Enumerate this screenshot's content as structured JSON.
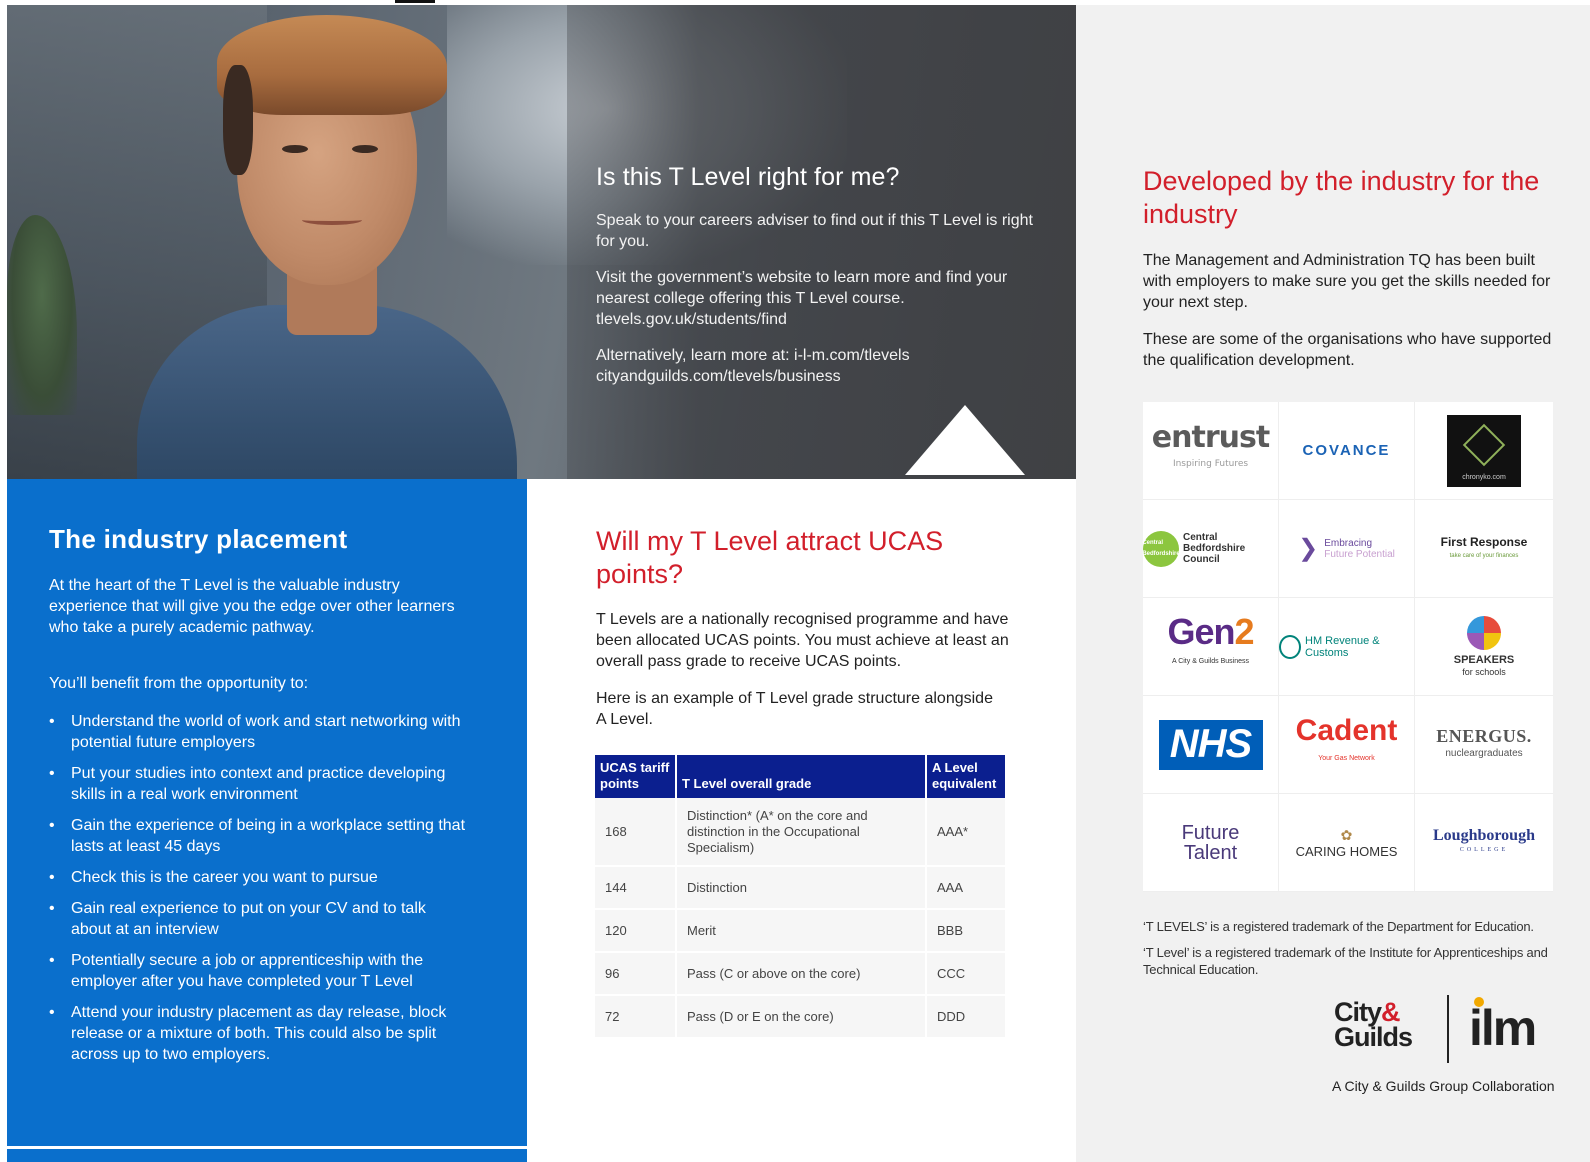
{
  "photo_section": {
    "title": "Is this T Level right for me?",
    "paragraphs": [
      "Speak to your careers adviser to find out if this T Level is right for you.",
      "Visit the government’s website to learn more and find your nearest college offering this T Level course. tlevels.gov.uk/students/find",
      "Alternatively, learn more at: i-l-m.com/tlevels cityandguilds.com/tlevels/business"
    ]
  },
  "industry": {
    "title": "Developed by the industry for the industry",
    "paragraphs": [
      "The Management and Administration TQ has been built with employers to make sure you get the skills needed for your next step.",
      "These are some of the organisations who have supported the qualification development."
    ],
    "logos": {
      "entrust": {
        "name": "entrust",
        "tagline": "Inspiring Futures"
      },
      "covance": {
        "name": "COVANCE"
      },
      "chronyko": {
        "name": "chronyko.com"
      },
      "cbc": {
        "badge": "Central Bedfordshire",
        "name": "Central Bedfordshire Council"
      },
      "embracing": {
        "line1": "Embracing",
        "line2": "Future Potential"
      },
      "first_response": {
        "name": "First Response",
        "tagline": "take care of your finances"
      },
      "gen2": {
        "name_a": "Gen",
        "name_b": "2",
        "tagline": "A City & Guilds Business"
      },
      "hmrc": {
        "name": "HM Revenue & Customs"
      },
      "speakers": {
        "name": "SPEAKERS",
        "tagline": "for schools"
      },
      "nhs": {
        "name": "NHS"
      },
      "cadent": {
        "name": "Cadent",
        "tagline": "Your Gas Network"
      },
      "energus": {
        "name": "ENERGUS.",
        "tagline": "nucleargraduates"
      },
      "future_talent": {
        "name": "Future Talent"
      },
      "caring_homes": {
        "name": "CARING HOMES"
      },
      "loughborough": {
        "name": "Loughborough",
        "tagline": "COLLEGE"
      }
    },
    "trademarks": [
      "‘T LEVELS’ is a registered trademark of the Department for Education.",
      "‘T Level’ is a registered trademark of the Institute for Apprenticeships and Technical Education."
    ],
    "brand": {
      "city": "City",
      "amp": "&",
      "guilds": "Guilds",
      "ilm": "ilm",
      "collab": "A City & Guilds Group Collaboration"
    }
  },
  "placement": {
    "title": "The industry placement",
    "lead": "At the heart of the T Level is the valuable industry experience that will give you the edge over other learners who take a purely academic pathway.",
    "benefit_intro": "You’ll benefit from the opportunity to:",
    "bullet": "•",
    "items": [
      "Understand the world of work and start networking with potential future employers",
      "Put your studies into context and practice developing skills in a real work environment",
      "Gain the experience of being in a workplace setting that lasts at least 45 days",
      "Check this is the career you want to pursue",
      "Gain real experience to put on your CV and to talk about at an interview",
      "Potentially secure a job or apprenticeship with the employer after you have completed your T Level",
      "Attend your industry placement as day release, block release or a mixture of both. This could also be split across up to two employers."
    ]
  },
  "ucas": {
    "title": "Will my T Level attract UCAS points?",
    "p1": "T Levels are a nationally recognised programme and have been allocated UCAS points. You must achieve at least an overall pass grade to receive UCAS points.",
    "p2": "Here is an example of T Level grade structure alongside A Level.",
    "table": {
      "headers": [
        "UCAS tariff points",
        "T Level overall grade",
        "A Level equivalent"
      ],
      "rows": [
        [
          "168",
          "Distinction* (A* on the core and distinction in the Occupational Specialism)",
          "AAA*"
        ],
        [
          "144",
          "Distinction",
          "AAA"
        ],
        [
          "120",
          "Merit",
          "BBB"
        ],
        [
          "96",
          "Pass (C or above on the core)",
          "CCC"
        ],
        [
          "72",
          "Pass (D or E on the core)",
          "DDD"
        ]
      ]
    }
  },
  "colors": {
    "brand_red": "#d21f2b",
    "placement_blue": "#0a6fcc",
    "table_header_navy": "#0b1f8f"
  }
}
